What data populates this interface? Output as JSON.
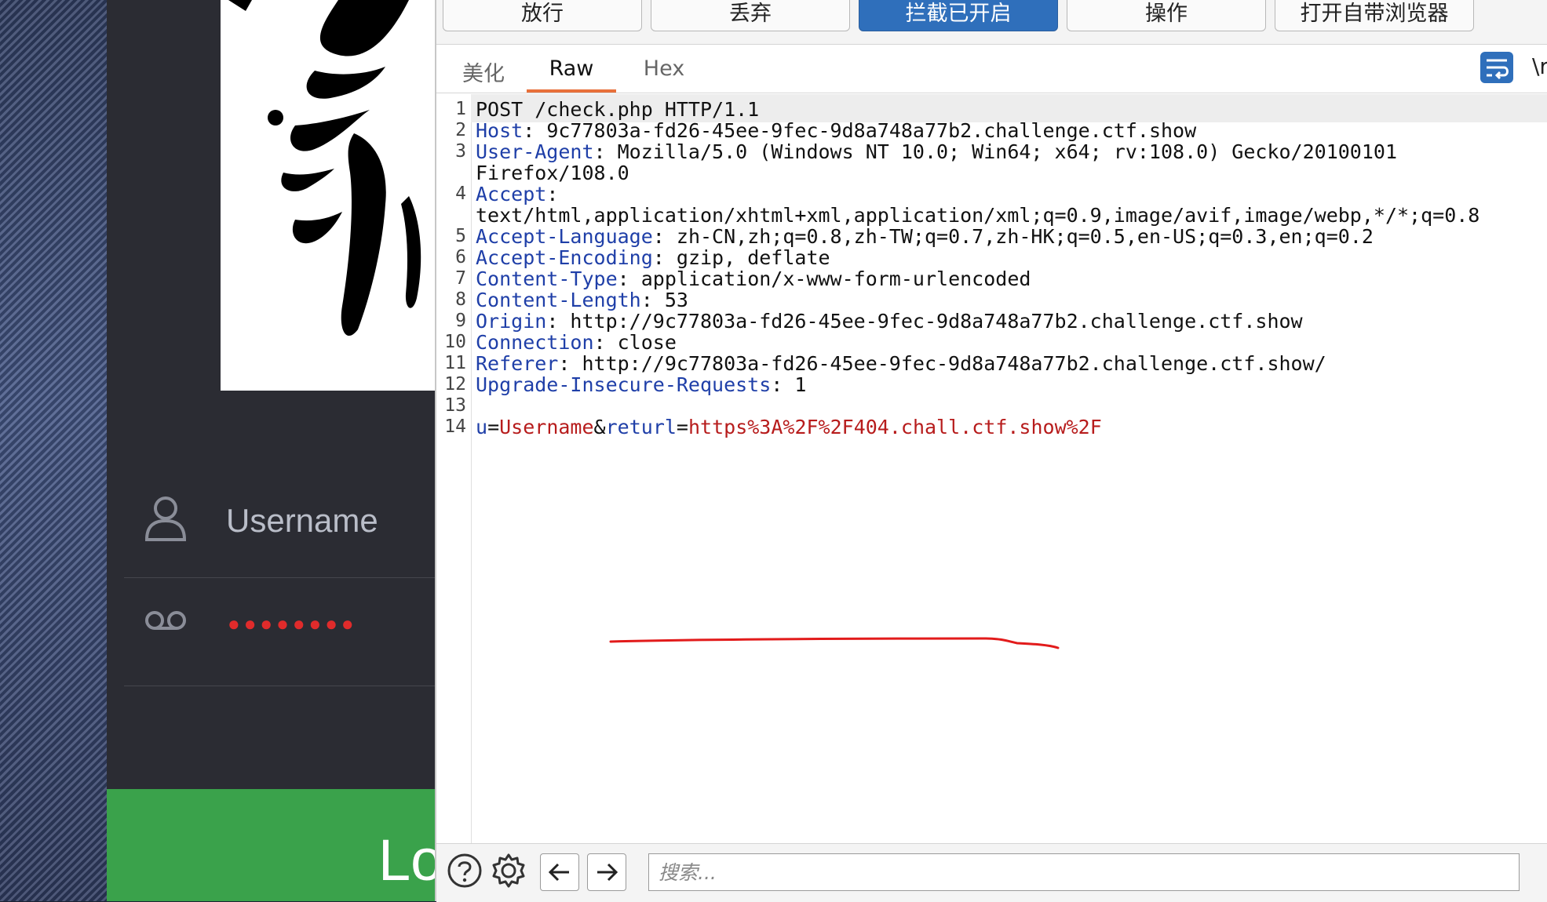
{
  "login": {
    "username_placeholder": "Username",
    "password_mask": "●●●●●●●●",
    "login_button_partial": "Lo"
  },
  "toolbar": {
    "forward": "放行",
    "drop": "丢弃",
    "intercept": "拦截已开启",
    "action": "操作",
    "open_browser": "打开自带浏览器"
  },
  "tabs": {
    "pretty": "美化",
    "raw": "Raw",
    "hex": "Hex"
  },
  "edge_text": "\\r",
  "request": {
    "line1": "POST /check.php HTTP/1.1",
    "headers": [
      {
        "name": "Host",
        "value": "9c77803a-fd26-45ee-9fec-9d8a748a77b2.challenge.ctf.show"
      },
      {
        "name": "User-Agent",
        "value": "Mozilla/5.0 (Windows NT 10.0; Win64; x64; rv:108.0) Gecko/20100101",
        "cont": "Firefox/108.0"
      },
      {
        "name": "Accept",
        "value": "",
        "cont": "text/html,application/xhtml+xml,application/xml;q=0.9,image/avif,image/webp,*/*;q=0.8"
      },
      {
        "name": "Accept-Language",
        "value": "zh-CN,zh;q=0.8,zh-TW;q=0.7,zh-HK;q=0.5,en-US;q=0.3,en;q=0.2"
      },
      {
        "name": "Accept-Encoding",
        "value": "gzip, deflate"
      },
      {
        "name": "Content-Type",
        "value": "application/x-www-form-urlencoded"
      },
      {
        "name": "Content-Length",
        "value": "53"
      },
      {
        "name": "Origin",
        "value": "http://9c77803a-fd26-45ee-9fec-9d8a748a77b2.challenge.ctf.show"
      },
      {
        "name": "Connection",
        "value": "close"
      },
      {
        "name": "Referer",
        "value": "http://9c77803a-fd26-45ee-9fec-9d8a748a77b2.challenge.ctf.show/"
      },
      {
        "name": "Upgrade-Insecure-Requests",
        "value": "1"
      }
    ],
    "body": {
      "p1_key": "u",
      "p1_val": "Username",
      "amp": "&",
      "p2_key": "returl",
      "p2_val": "https%3A%2F%2F404.chall.ctf.show%2F"
    },
    "line_numbers": [
      "1",
      "2",
      "3",
      "4",
      "5",
      "6",
      "7",
      "8",
      "9",
      "10",
      "11",
      "12",
      "13",
      "14"
    ]
  },
  "search": {
    "placeholder": "搜索..."
  },
  "colors": {
    "intercept_active": "#2f6fbb",
    "header_key": "#1f3fa8",
    "param_value": "#b71c1c",
    "tab_underline": "#e8703a",
    "annotation_red": "#e21b1b",
    "login_green": "#3aa24b"
  }
}
